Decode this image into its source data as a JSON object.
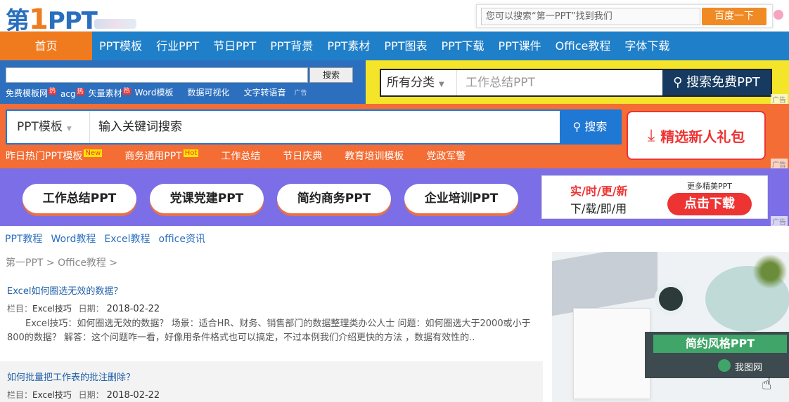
{
  "header": {
    "logo": {
      "main": "第",
      "num": "1",
      "suffix": "PPT"
    },
    "search_placeholder": "您可以搜索“第一PPT”找到我们",
    "search_button": "百度一下"
  },
  "nav": {
    "home": "首页",
    "items": [
      "PPT模板",
      "行业PPT",
      "节日PPT",
      "PPT背景",
      "PPT素材",
      "PPT图表",
      "PPT下载",
      "PPT课件",
      "Office教程",
      "字体下载"
    ]
  },
  "band1": {
    "search_button": "搜索",
    "links": [
      "免费模板网",
      "acg",
      "矢量素材",
      "Word模板",
      "数据可视化",
      "文字转语音"
    ],
    "hot_label": "热",
    "ad_label": "广告",
    "category": "所有分类",
    "placeholder": "工作总结PPT",
    "go": "搜索免费PPT",
    "ad": "广告"
  },
  "band2": {
    "category": "PPT模板",
    "placeholder": "输入关键词搜索",
    "go": "搜索",
    "links": [
      {
        "label": "昨日热门PPT模板",
        "tag": "New"
      },
      {
        "label": "商务通用PPT",
        "tag": "Hot"
      },
      {
        "label": "工作总结",
        "tag": ""
      },
      {
        "label": "节日庆典",
        "tag": ""
      },
      {
        "label": "教育培训模板",
        "tag": ""
      },
      {
        "label": "党政军警",
        "tag": ""
      }
    ],
    "gift": "精选新人礼包",
    "ad": "广告"
  },
  "band3": {
    "pills": [
      "工作总结PPT",
      "党课党建PPT",
      "简约商务PPT",
      "企业培训PPT"
    ],
    "promo": {
      "line1": "实/时/更/新",
      "line2": "下/载/即/用",
      "more": "更多精美PPT",
      "button": "点击下载"
    },
    "ad": "广告"
  },
  "subnav": [
    "PPT教程",
    "Word教程",
    "Excel教程",
    "office资讯"
  ],
  "breadcrumb": "第一PPT > Office教程 >",
  "articles": [
    {
      "title": "Excel如何圈选无效的数据？",
      "category_label": "栏目：",
      "category": "Excel技巧",
      "date_label": "日期：",
      "date": "2018-02-22",
      "desc": "Excel技巧：如何圈选无效的数据？ 场景：适合HR、财务、销售部门的数据整理类办公人士 问题：如何圈选大于2000或小于800的数据？ 解答：这个问题咋一看，好像用条件格式也可以搞定，不过本例我们介绍更快的方法 ，数据有效性的.."
    },
    {
      "title": "如何批量把工作表的批注删除？",
      "category_label": "栏目：",
      "category": "Excel技巧",
      "date_label": "日期：",
      "date": "2018-02-22"
    }
  ],
  "side_ad": {
    "title": "简约风格PPT",
    "brand": "我图网"
  }
}
